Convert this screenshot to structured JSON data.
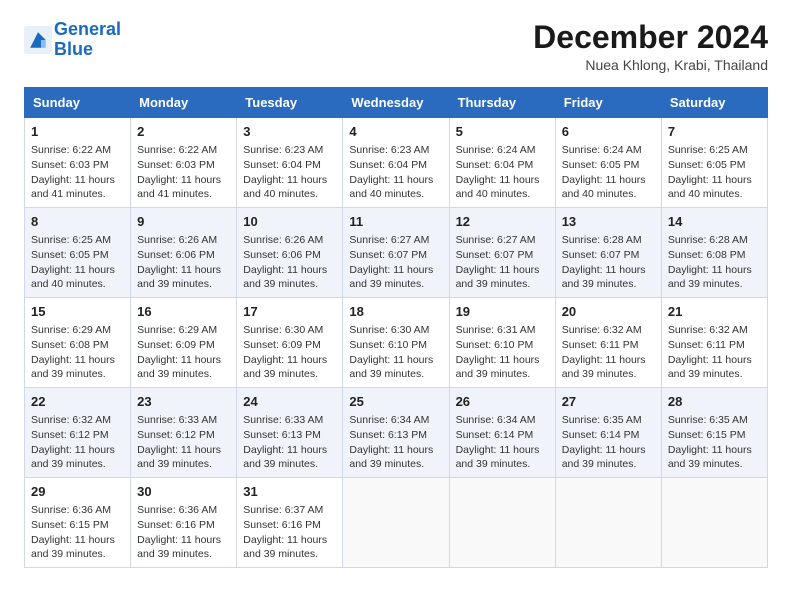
{
  "header": {
    "logo_line1": "General",
    "logo_line2": "Blue",
    "month": "December 2024",
    "location": "Nuea Khlong, Krabi, Thailand"
  },
  "days_of_week": [
    "Sunday",
    "Monday",
    "Tuesday",
    "Wednesday",
    "Thursday",
    "Friday",
    "Saturday"
  ],
  "weeks": [
    [
      {
        "day": "1",
        "info": "Sunrise: 6:22 AM\nSunset: 6:03 PM\nDaylight: 11 hours and 41 minutes."
      },
      {
        "day": "2",
        "info": "Sunrise: 6:22 AM\nSunset: 6:03 PM\nDaylight: 11 hours and 41 minutes."
      },
      {
        "day": "3",
        "info": "Sunrise: 6:23 AM\nSunset: 6:04 PM\nDaylight: 11 hours and 40 minutes."
      },
      {
        "day": "4",
        "info": "Sunrise: 6:23 AM\nSunset: 6:04 PM\nDaylight: 11 hours and 40 minutes."
      },
      {
        "day": "5",
        "info": "Sunrise: 6:24 AM\nSunset: 6:04 PM\nDaylight: 11 hours and 40 minutes."
      },
      {
        "day": "6",
        "info": "Sunrise: 6:24 AM\nSunset: 6:05 PM\nDaylight: 11 hours and 40 minutes."
      },
      {
        "day": "7",
        "info": "Sunrise: 6:25 AM\nSunset: 6:05 PM\nDaylight: 11 hours and 40 minutes."
      }
    ],
    [
      {
        "day": "8",
        "info": "Sunrise: 6:25 AM\nSunset: 6:05 PM\nDaylight: 11 hours and 40 minutes."
      },
      {
        "day": "9",
        "info": "Sunrise: 6:26 AM\nSunset: 6:06 PM\nDaylight: 11 hours and 39 minutes."
      },
      {
        "day": "10",
        "info": "Sunrise: 6:26 AM\nSunset: 6:06 PM\nDaylight: 11 hours and 39 minutes."
      },
      {
        "day": "11",
        "info": "Sunrise: 6:27 AM\nSunset: 6:07 PM\nDaylight: 11 hours and 39 minutes."
      },
      {
        "day": "12",
        "info": "Sunrise: 6:27 AM\nSunset: 6:07 PM\nDaylight: 11 hours and 39 minutes."
      },
      {
        "day": "13",
        "info": "Sunrise: 6:28 AM\nSunset: 6:07 PM\nDaylight: 11 hours and 39 minutes."
      },
      {
        "day": "14",
        "info": "Sunrise: 6:28 AM\nSunset: 6:08 PM\nDaylight: 11 hours and 39 minutes."
      }
    ],
    [
      {
        "day": "15",
        "info": "Sunrise: 6:29 AM\nSunset: 6:08 PM\nDaylight: 11 hours and 39 minutes."
      },
      {
        "day": "16",
        "info": "Sunrise: 6:29 AM\nSunset: 6:09 PM\nDaylight: 11 hours and 39 minutes."
      },
      {
        "day": "17",
        "info": "Sunrise: 6:30 AM\nSunset: 6:09 PM\nDaylight: 11 hours and 39 minutes."
      },
      {
        "day": "18",
        "info": "Sunrise: 6:30 AM\nSunset: 6:10 PM\nDaylight: 11 hours and 39 minutes."
      },
      {
        "day": "19",
        "info": "Sunrise: 6:31 AM\nSunset: 6:10 PM\nDaylight: 11 hours and 39 minutes."
      },
      {
        "day": "20",
        "info": "Sunrise: 6:32 AM\nSunset: 6:11 PM\nDaylight: 11 hours and 39 minutes."
      },
      {
        "day": "21",
        "info": "Sunrise: 6:32 AM\nSunset: 6:11 PM\nDaylight: 11 hours and 39 minutes."
      }
    ],
    [
      {
        "day": "22",
        "info": "Sunrise: 6:32 AM\nSunset: 6:12 PM\nDaylight: 11 hours and 39 minutes."
      },
      {
        "day": "23",
        "info": "Sunrise: 6:33 AM\nSunset: 6:12 PM\nDaylight: 11 hours and 39 minutes."
      },
      {
        "day": "24",
        "info": "Sunrise: 6:33 AM\nSunset: 6:13 PM\nDaylight: 11 hours and 39 minutes."
      },
      {
        "day": "25",
        "info": "Sunrise: 6:34 AM\nSunset: 6:13 PM\nDaylight: 11 hours and 39 minutes."
      },
      {
        "day": "26",
        "info": "Sunrise: 6:34 AM\nSunset: 6:14 PM\nDaylight: 11 hours and 39 minutes."
      },
      {
        "day": "27",
        "info": "Sunrise: 6:35 AM\nSunset: 6:14 PM\nDaylight: 11 hours and 39 minutes."
      },
      {
        "day": "28",
        "info": "Sunrise: 6:35 AM\nSunset: 6:15 PM\nDaylight: 11 hours and 39 minutes."
      }
    ],
    [
      {
        "day": "29",
        "info": "Sunrise: 6:36 AM\nSunset: 6:15 PM\nDaylight: 11 hours and 39 minutes."
      },
      {
        "day": "30",
        "info": "Sunrise: 6:36 AM\nSunset: 6:16 PM\nDaylight: 11 hours and 39 minutes."
      },
      {
        "day": "31",
        "info": "Sunrise: 6:37 AM\nSunset: 6:16 PM\nDaylight: 11 hours and 39 minutes."
      },
      null,
      null,
      null,
      null
    ]
  ]
}
